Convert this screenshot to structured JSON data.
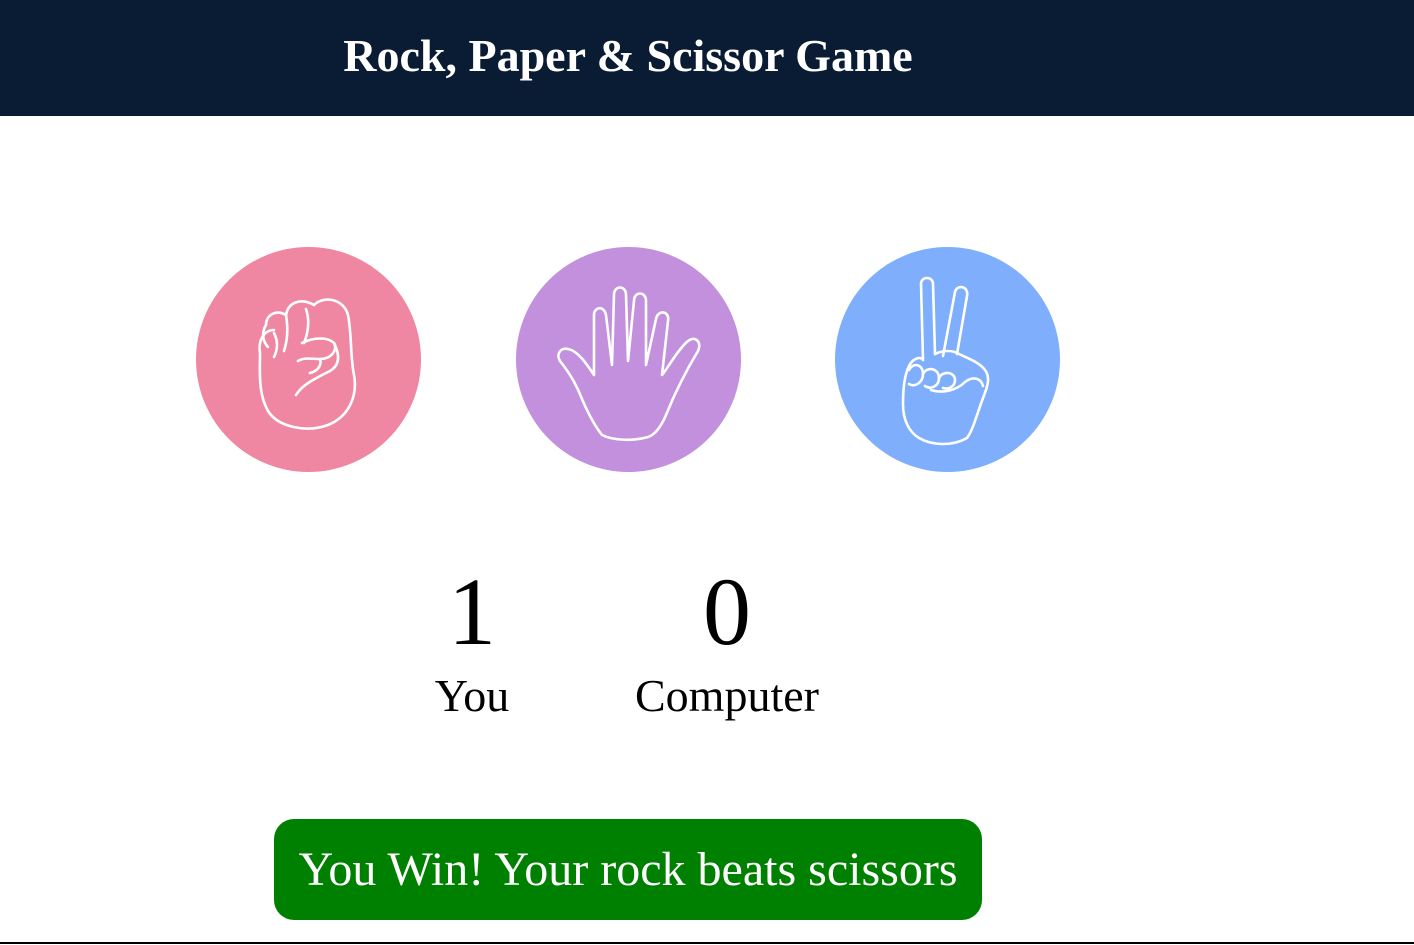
{
  "header": {
    "title": "Rock, Paper & Scissor Game"
  },
  "choices": [
    {
      "id": "rock",
      "icon": "rock-fist-icon",
      "color": "#f087a2"
    },
    {
      "id": "paper",
      "icon": "paper-hand-icon",
      "color": "#c290dd"
    },
    {
      "id": "scissors",
      "icon": "scissors-hand-icon",
      "color": "#7faefc"
    }
  ],
  "scoreboard": {
    "user_score": "1",
    "user_label": "You",
    "computer_score": "0",
    "computer_label": "Computer"
  },
  "message": {
    "text": "You Win! Your rock beats scissors",
    "color": "#008000"
  },
  "colors": {
    "header_bg": "#0a1c33"
  }
}
